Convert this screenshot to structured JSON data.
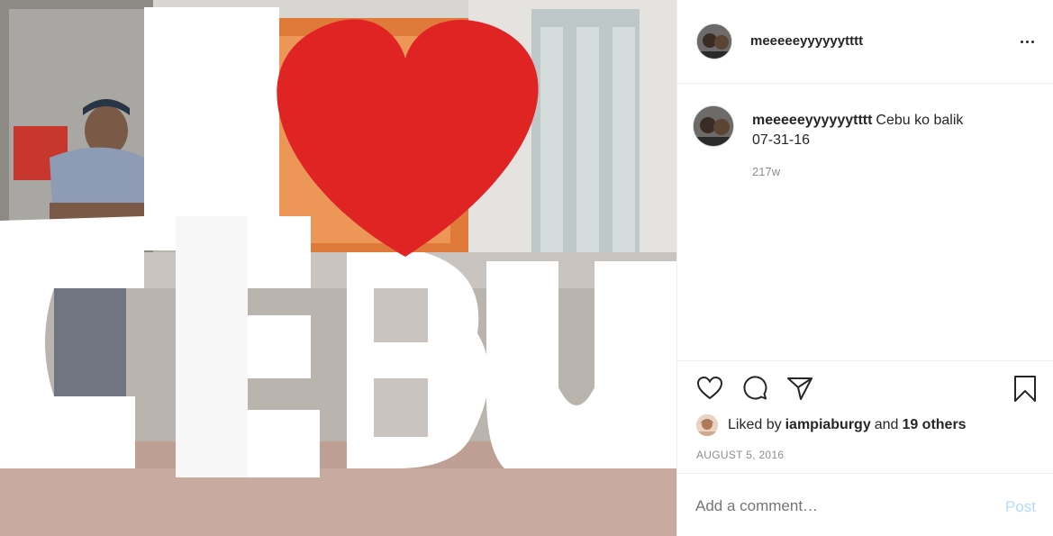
{
  "post": {
    "photo_alt": "",
    "author": {
      "username": "meeeeeyyyyyytttt",
      "avatar_icon": "profile-photo"
    },
    "header_more_icon": "ellipsis-icon",
    "caption": {
      "username": "meeeeeyyyyyytttt",
      "line1": "Cebu ko balik",
      "line2": "07-31-16",
      "age": "217w"
    },
    "actions": {
      "like_icon": "heart-outline-icon",
      "comment_icon": "speech-bubble-icon",
      "share_icon": "paper-plane-icon",
      "save_icon": "bookmark-icon"
    },
    "likes": {
      "prefix": "Liked by",
      "liker": "iampiaburgy",
      "joiner": "and",
      "others": "19 others"
    },
    "date": "AUGUST 5, 2016",
    "comment_box": {
      "placeholder": "Add a comment…",
      "post_label": "Post"
    },
    "colors": {
      "post_disabled": "#b3dbff",
      "muted_text": "#8e8e8e",
      "border": "#efefef",
      "heart_red": "#e02424"
    }
  }
}
